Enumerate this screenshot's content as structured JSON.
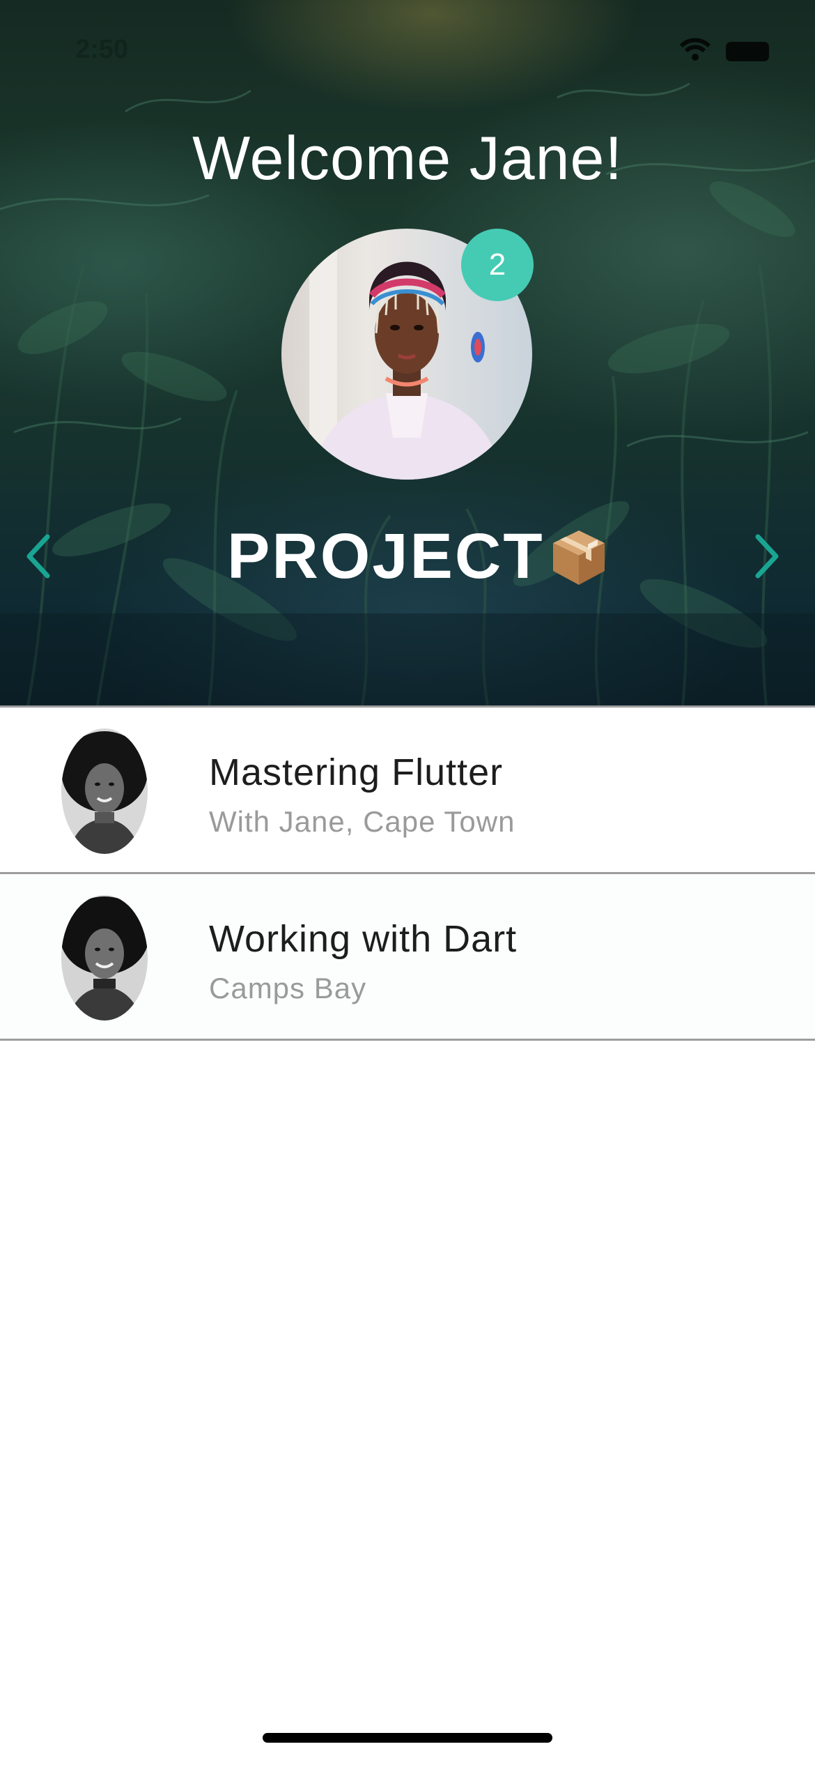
{
  "status_bar": {
    "time": "2:50",
    "wifi_icon": "wifi-icon",
    "battery_icon": "battery-icon"
  },
  "header": {
    "welcome": "Welcome Jane!",
    "notification_count": "2",
    "project_title": "PROJECT",
    "project_icon": "package-box-icon",
    "prev_icon": "chevron-left-icon",
    "next_icon": "chevron-right-icon"
  },
  "colors": {
    "accent": "#45cbb4",
    "arrow": "#1aa593",
    "divider": "#9c9c9c",
    "title_text": "#1d1d1d",
    "subtitle_text": "#9a9a9a"
  },
  "list": {
    "items": [
      {
        "title": "Mastering Flutter",
        "subtitle": "With Jane, Cape Town"
      },
      {
        "title": "Working with Dart",
        "subtitle": "Camps Bay"
      }
    ]
  }
}
